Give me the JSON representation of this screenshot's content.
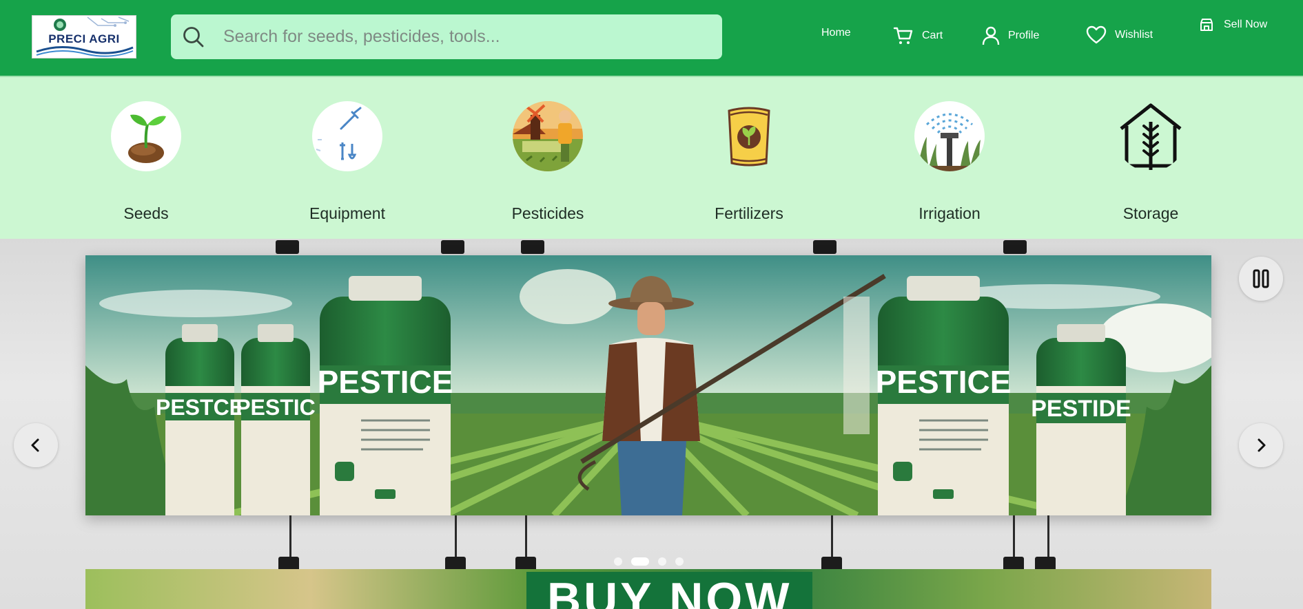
{
  "header": {
    "logo_text": "PRECI AGRI",
    "search_placeholder": "Search for seeds, pesticides, tools...",
    "nav": {
      "home": "Home",
      "cart": "Cart",
      "profile": "Profile",
      "wishlist": "Wishlist",
      "sell": "Sell Now"
    },
    "colors": {
      "header_bg": "#16a34a",
      "search_bg": "#bbf7d0"
    }
  },
  "categories": [
    {
      "label": "Seeds",
      "icon": "seed-sprout-icon"
    },
    {
      "label": "Equipment",
      "icon": "tools-icon"
    },
    {
      "label": "Pesticides",
      "icon": "farmer-field-icon"
    },
    {
      "label": "Fertilizers",
      "icon": "fertilizer-bag-icon"
    },
    {
      "label": "Irrigation",
      "icon": "sprinkler-icon"
    },
    {
      "label": "Storage",
      "icon": "storage-barn-icon"
    }
  ],
  "carousel": {
    "banner_bottle_text": "PESTICE",
    "next_banner_text": "BUY NOW",
    "slide_count": 4,
    "active_slide": 2,
    "controls": {
      "prev": "chevron-left-icon",
      "next": "chevron-right-icon",
      "pause": "pause-icon"
    }
  }
}
